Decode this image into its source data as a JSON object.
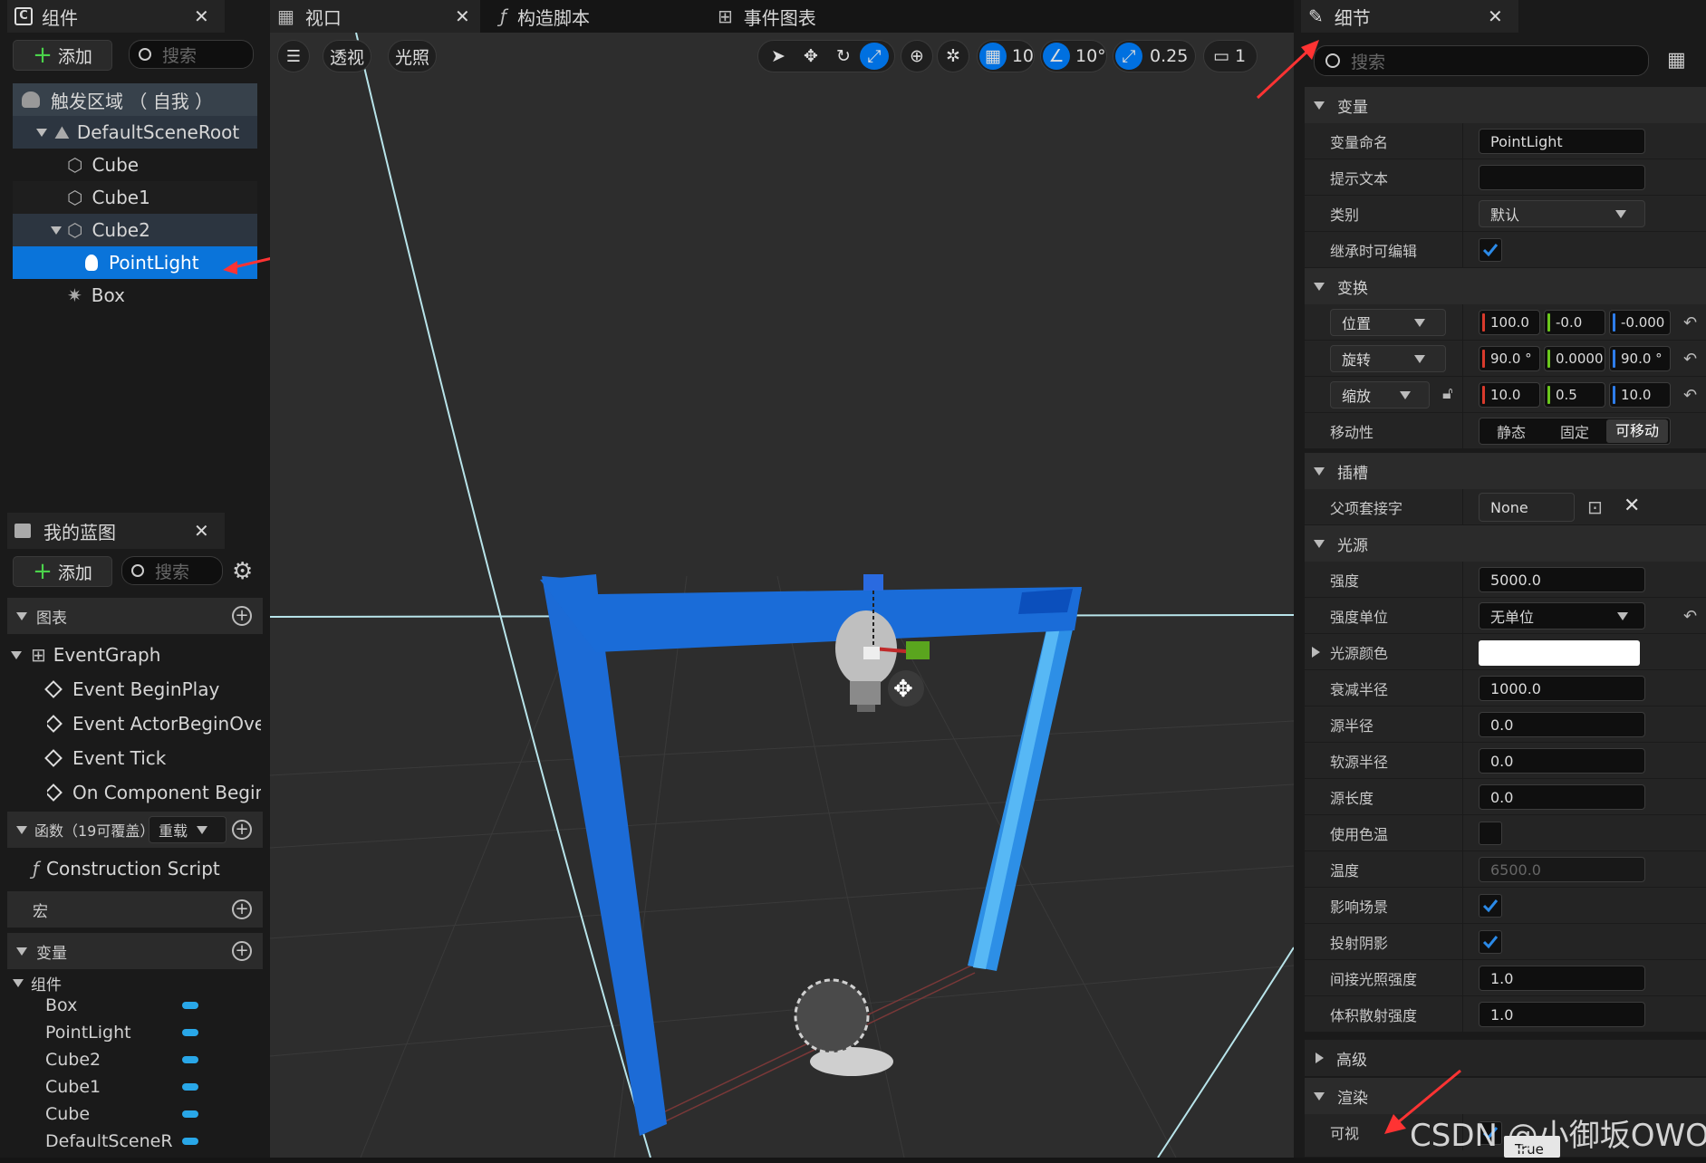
{
  "components_panel": {
    "title": "组件",
    "add_label": "添加",
    "search_placeholder": "搜索",
    "root_label": "触发区域 （ 自我 ）",
    "tree": [
      {
        "label": "DefaultSceneRoot",
        "icon": "scene-root-icon"
      },
      {
        "label": "Cube",
        "icon": "cube-icon"
      },
      {
        "label": "Cube1",
        "icon": "cube-icon"
      },
      {
        "label": "Cube2",
        "icon": "cube-icon"
      },
      {
        "label": "PointLight",
        "icon": "lightbulb-icon",
        "selected": true
      },
      {
        "label": "Box",
        "icon": "box-collision-icon"
      }
    ]
  },
  "blueprint_panel": {
    "title": "我的蓝图",
    "add_label": "添加",
    "search_placeholder": "搜索",
    "graphs_label": "图表",
    "event_graph": "EventGraph",
    "events": [
      "Event BeginPlay",
      "Event ActorBeginOverla",
      "Event Tick",
      "On Component Begin O"
    ],
    "functions_label": "函数（19可覆盖）",
    "override_label": "重载",
    "construction_script": "Construction Script",
    "macros_label": "宏",
    "variables_label": "变量",
    "components_label": "组件",
    "variables": [
      "Box",
      "PointLight",
      "Cube2",
      "Cube1",
      "Cube",
      "DefaultSceneR"
    ]
  },
  "tabs": {
    "viewport": "视口",
    "construction": "构造脚本",
    "event_graph": "事件图表"
  },
  "viewport_toolbar": {
    "perspective": "透视",
    "lighting": "光照",
    "grid_snap": "10",
    "rotation_snap": "10°",
    "scale_snap": "0.25",
    "camera_speed": "1"
  },
  "details": {
    "title": "细节",
    "search_placeholder": "搜索",
    "sections": {
      "variable": "变量",
      "transform": "变换",
      "socket": "插槽",
      "light": "光源",
      "advanced": "高级",
      "rendering": "渲染"
    },
    "variable_name_label": "变量命名",
    "variable_name_value": "PointLight",
    "tooltip_label": "提示文本",
    "category_label": "类别",
    "category_value": "默认",
    "editable_label": "继承时可编辑",
    "location_label": "位置",
    "location": [
      "100.0",
      "-0.0",
      "-0.000"
    ],
    "rotation_label": "旋转",
    "rotation": [
      "90.0 °",
      "0.0000",
      "90.0 °"
    ],
    "scale_label": "缩放",
    "scale": [
      "10.0",
      "0.5",
      "10.0"
    ],
    "mobility_label": "移动性",
    "mobility_options": [
      "静态",
      "固定",
      "可移动"
    ],
    "parent_socket_label": "父项套接字",
    "parent_socket_value": "None",
    "intensity_label": "强度",
    "intensity_value": "5000.0",
    "intensity_units_label": "强度单位",
    "intensity_units_value": "无单位",
    "light_color_label": "光源颜色",
    "attenuation_label": "衰减半径",
    "attenuation_value": "1000.0",
    "source_radius_label": "源半径",
    "source_radius_value": "0.0",
    "soft_source_radius_label": "软源半径",
    "soft_source_radius_value": "0.0",
    "source_length_label": "源长度",
    "source_length_value": "0.0",
    "use_temperature_label": "使用色温",
    "temperature_label": "温度",
    "temperature_value": "6500.0",
    "affects_world_label": "影响场景",
    "cast_shadows_label": "投射阴影",
    "indirect_label": "间接光照强度",
    "indirect_value": "1.0",
    "volumetric_label": "体积散射强度",
    "volumetric_value": "1.0",
    "visible_label": "可视",
    "tooltip_true": "True"
  },
  "watermark": "CSDN @小御坂OWO",
  "colors": {
    "accent": "#0070e0",
    "selection": "#0a74da",
    "annotation": "#ff3333"
  }
}
